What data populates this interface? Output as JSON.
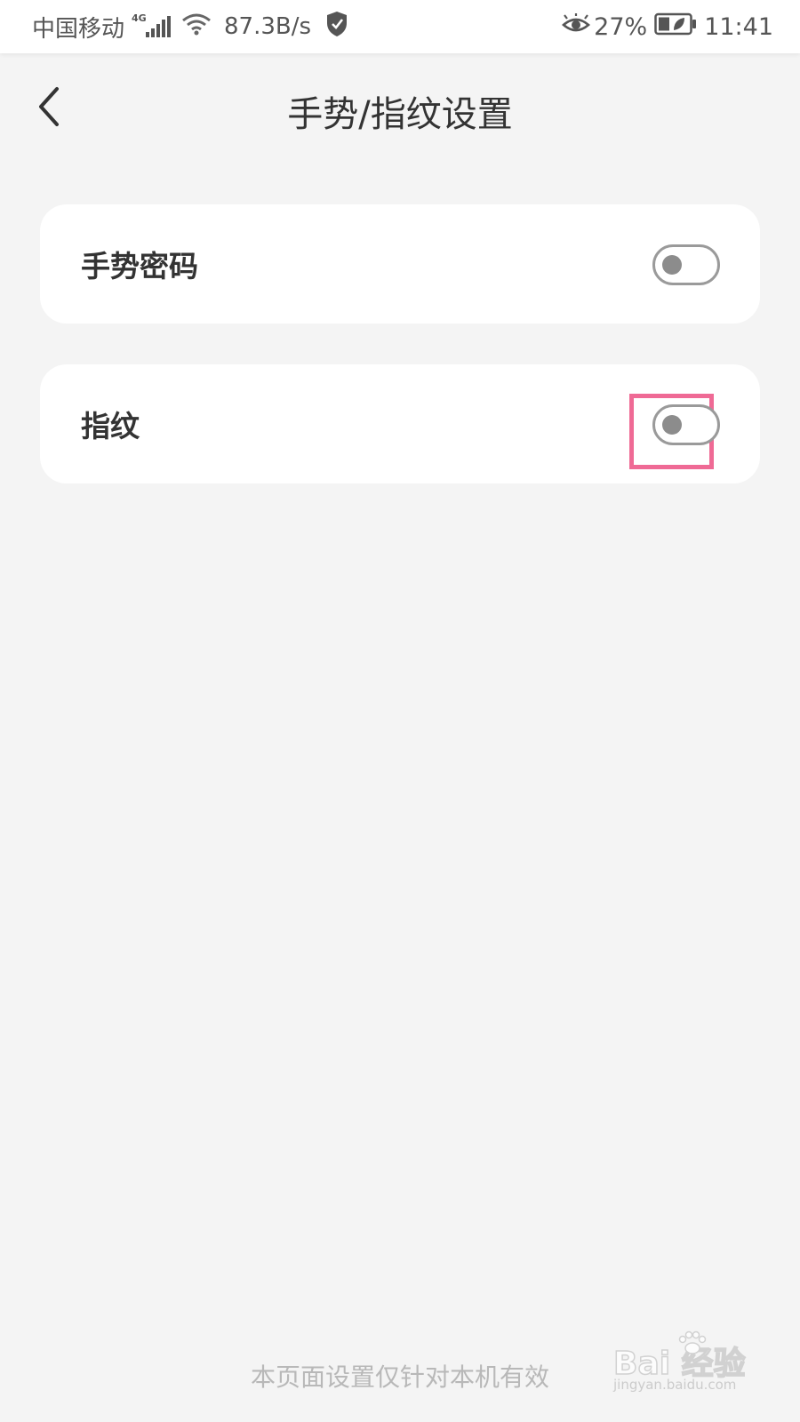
{
  "status_bar": {
    "carrier": "中国移动",
    "network_type": "4G",
    "net_speed": "87.3B/s",
    "battery_percent": "27%",
    "time": "11:41",
    "icons": [
      "signal-icon",
      "wifi-icon",
      "shield-icon",
      "eye-icon",
      "battery-icon"
    ]
  },
  "header": {
    "title": "手势/指纹设置",
    "back_icon": "chevron-left-icon"
  },
  "settings": [
    {
      "label": "手势密码",
      "enabled": false
    },
    {
      "label": "指纹",
      "enabled": false,
      "highlighted": true
    }
  ],
  "footer": {
    "note": "本页面设置仅针对本机有效"
  },
  "watermark": {
    "main": "Bai 经验",
    "sub": "jingyan.baidu.com"
  },
  "colors": {
    "background": "#f4f4f4",
    "card": "#ffffff",
    "text_primary": "#333333",
    "text_muted": "#b8b8b8",
    "toggle_off": "#9a9a9a",
    "highlight": "#ef6a95"
  }
}
